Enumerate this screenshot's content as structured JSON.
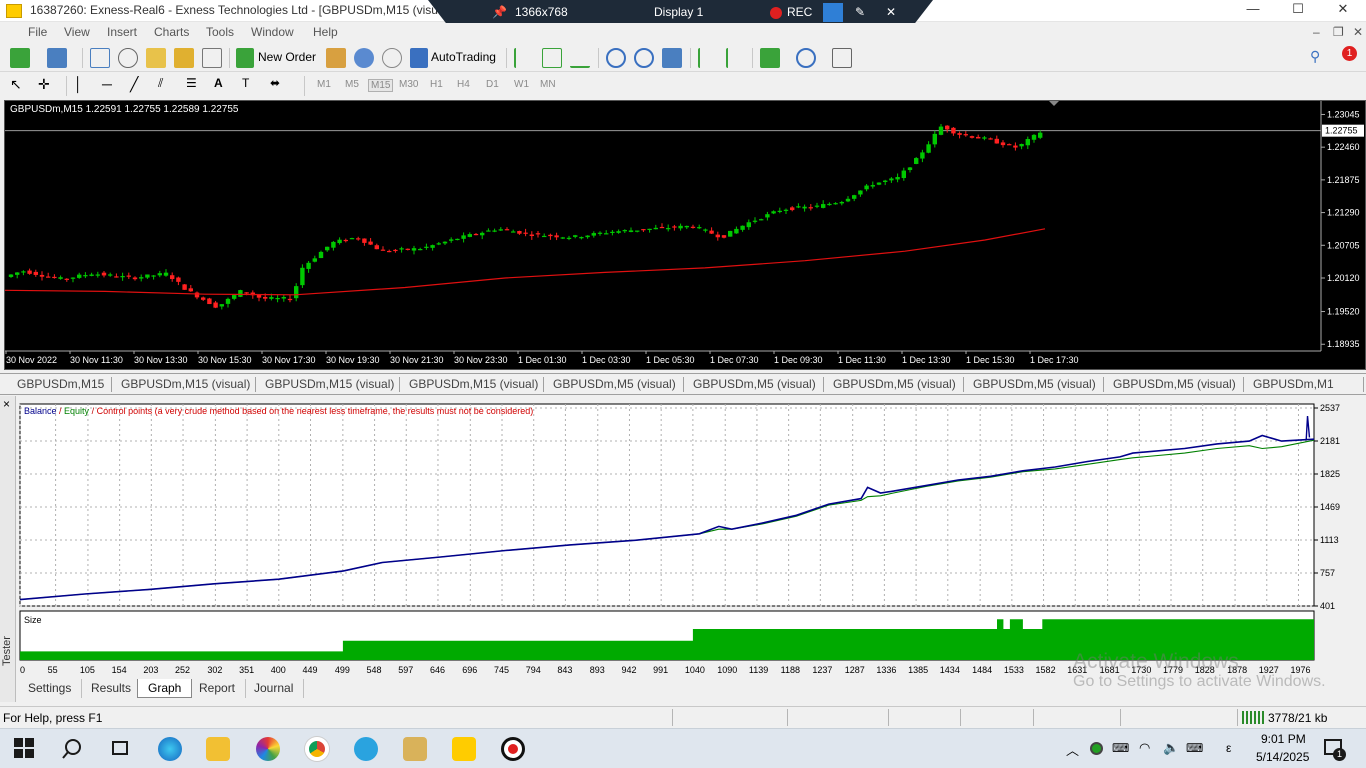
{
  "window": {
    "title": "16387260: Exness-Real6 - Exness Technologies Ltd - [GBPUSDm,M15 (visual)]",
    "minimize": "—",
    "maximize": "☐",
    "close": "✕"
  },
  "remote_bar": {
    "resolution": "1366x768",
    "display": "Display 1",
    "rec": "REC"
  },
  "menu": {
    "items": [
      "File",
      "View",
      "Insert",
      "Charts",
      "Tools",
      "Window",
      "Help"
    ]
  },
  "toolbar": {
    "new_order": "New Order",
    "autotrading": "AutoTrading",
    "notification_count": "1"
  },
  "timeframes": {
    "items": [
      "M1",
      "M5",
      "M15",
      "M30",
      "H1",
      "H4",
      "D1",
      "W1",
      "MN"
    ],
    "selected": "M15"
  },
  "chart": {
    "symbol_header": "GBPUSDm,M15  1.22591 1.22755 1.22589 1.22755",
    "current_price": "1.22755",
    "price_ticks": [
      "1.23045",
      "1.22460",
      "1.21875",
      "1.21290",
      "1.20705",
      "1.20120",
      "1.19520",
      "1.18935"
    ],
    "time_ticks": [
      "30 Nov 2022",
      "30 Nov 11:30",
      "30 Nov 13:30",
      "30 Nov 15:30",
      "30 Nov 17:30",
      "30 Nov 19:30",
      "30 Nov 21:30",
      "30 Nov 23:30",
      "1 Dec 01:30",
      "1 Dec 03:30",
      "1 Dec 05:30",
      "1 Dec 07:30",
      "1 Dec 09:30",
      "1 Dec 11:30",
      "1 Dec 13:30",
      "1 Dec 15:30",
      "1 Dec 17:30"
    ],
    "colors": {
      "bull": "#00c800",
      "bear": "#ff2020",
      "ma": "#e01010",
      "background": "#000000"
    }
  },
  "chart_tabs": [
    "GBPUSDm,M15",
    "GBPUSDm,M15 (visual)",
    "GBPUSDm,M15 (visual)",
    "GBPUSDm,M15 (visual)",
    "GBPUSDm,M5 (visual)",
    "GBPUSDm,M5 (visual)",
    "GBPUSDm,M5 (visual)",
    "GBPUSDm,M5 (visual)",
    "GBPUSDm,M5 (visual)",
    "GBPUSDm,M1"
  ],
  "tester": {
    "side_label": "Tester",
    "close": "×",
    "legend": {
      "balance": "Balance",
      "sep1": " / ",
      "equity": "Equity",
      "sep2": " / ",
      "control": "Control points (a very crude method based on the nearest less timeframe, the results must not be considered)"
    },
    "size_label": "Size",
    "tabs": [
      "Settings",
      "Results",
      "Graph",
      "Report",
      "Journal"
    ],
    "active_tab": "Graph"
  },
  "chart_data": {
    "type": "line",
    "title": "",
    "y_ticks": [
      2537,
      2181,
      1825,
      1469,
      1113,
      757,
      401
    ],
    "ylim": [
      401,
      2537
    ],
    "x_ticks": [
      0,
      55,
      105,
      154,
      203,
      252,
      302,
      351,
      400,
      449,
      499,
      548,
      597,
      646,
      696,
      745,
      794,
      843,
      893,
      942,
      991,
      1040,
      1090,
      1139,
      1188,
      1237,
      1287,
      1336,
      1385,
      1434,
      1484,
      1533,
      1582,
      1631,
      1681,
      1730,
      1779,
      1828,
      1878,
      1927,
      1976
    ],
    "xlim": [
      0,
      2000
    ],
    "series": [
      {
        "name": "Balance",
        "color": "#00008b",
        "x": [
          0,
          100,
          200,
          300,
          400,
          500,
          560,
          650,
          750,
          850,
          950,
          1050,
          1080,
          1100,
          1150,
          1200,
          1250,
          1300,
          1310,
          1330,
          1350,
          1400,
          1450,
          1500,
          1550,
          1600,
          1650,
          1700,
          1720,
          1800,
          1850,
          1900,
          1920,
          1950,
          2000
        ],
        "y": [
          470,
          530,
          580,
          640,
          690,
          780,
          870,
          930,
          1000,
          1060,
          1110,
          1180,
          1260,
          1230,
          1300,
          1380,
          1500,
          1560,
          1680,
          1620,
          1640,
          1700,
          1760,
          1800,
          1860,
          1900,
          1960,
          2010,
          2050,
          2100,
          2150,
          2180,
          2240,
          2180,
          2200
        ]
      },
      {
        "name": "Equity",
        "color": "#008000",
        "x": [
          0,
          100,
          200,
          300,
          400,
          500,
          560,
          650,
          750,
          850,
          950,
          1050,
          1080,
          1100,
          1150,
          1200,
          1250,
          1300,
          1310,
          1330,
          1350,
          1400,
          1450,
          1500,
          1550,
          1600,
          1650,
          1700,
          1720,
          1800,
          1850,
          1900,
          1920,
          1950,
          2000
        ],
        "y": [
          470,
          530,
          580,
          640,
          690,
          780,
          870,
          930,
          1000,
          1060,
          1110,
          1180,
          1230,
          1230,
          1290,
          1370,
          1490,
          1540,
          1580,
          1590,
          1620,
          1690,
          1750,
          1790,
          1850,
          1880,
          1930,
          1980,
          2000,
          2050,
          2100,
          2130,
          2100,
          2120,
          2190
        ]
      }
    ],
    "size_levels": {
      "x": [
        0,
        499,
        1040,
        1500,
        1510,
        1520,
        1530,
        1540,
        1550,
        1560,
        1570,
        1580,
        2000
      ],
      "level": [
        0.2,
        0.45,
        0.72,
        0.72,
        0.95,
        0.72,
        0.95,
        0.95,
        0.72,
        0.72,
        0.72,
        0.95,
        0.95
      ]
    }
  },
  "statusbar": {
    "help": "For Help, press F1",
    "traffic": "3778/21 kb"
  },
  "watermark": {
    "line1": "Activate Windows",
    "line2": "Go to Settings to activate Windows."
  },
  "taskbar": {
    "time": "9:01 PM",
    "date": "5/14/2025",
    "lang": "ε",
    "notify_count": "1"
  }
}
